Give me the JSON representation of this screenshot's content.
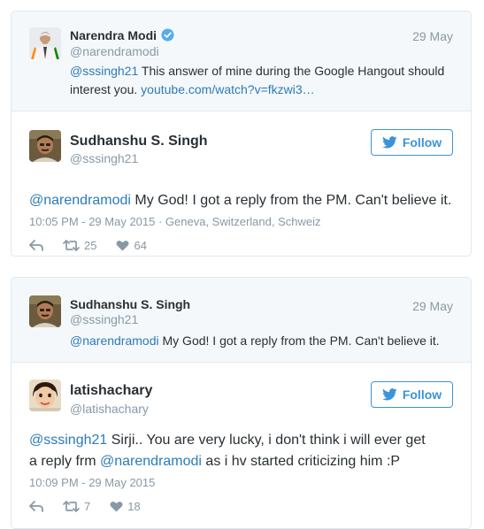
{
  "colors": {
    "link": "#2b7bb9",
    "follow_blue": "#3b94d9",
    "muted": "#8899a6",
    "text": "#292f33",
    "quoted_bg": "#f5f8fa",
    "border": "#e1e8ed"
  },
  "cards": [
    {
      "quoted": {
        "name": "Narendra Modi",
        "verified": true,
        "handle": "@narendramodi",
        "date": "29 May",
        "mention": "@sssingh21",
        "text": " This answer of mine during the Google Hangout should interest you. ",
        "url": "youtube.com/watch?v=fkzwi3…"
      },
      "main": {
        "name": "Sudhanshu S. Singh",
        "handle": "@sssingh21",
        "follow_label": "Follow",
        "follow_icon": "twitter-bird-icon",
        "mention": "@narendramodi",
        "text": " My God! I got a reply from the PM. Can't believe it.",
        "timestamp": "10:05 PM - 29 May 2015 · Geneva, Switzerland, Schweiz",
        "replies_icon": "reply-icon",
        "retweets": "25",
        "likes": "64"
      }
    },
    {
      "quoted": {
        "name": "Sudhanshu S. Singh",
        "verified": false,
        "handle": "@sssingh21",
        "date": "29 May",
        "mention": "@narendramodi",
        "text": " My God! I got a reply from the PM. Can't believe it."
      },
      "main": {
        "name": "latishachary",
        "handle": "@latishachary",
        "follow_label": "Follow",
        "follow_icon": "twitter-bird-icon",
        "mention1": "@sssingh21",
        "text1": " Sirji.. You are very lucky, i don't think i will ever get a reply frm ",
        "mention2": "@narendramodi",
        "text2": " as i hv started criticizing him :P",
        "timestamp": "10:09 PM - 29 May 2015",
        "retweets": "7",
        "likes": "18"
      }
    }
  ]
}
